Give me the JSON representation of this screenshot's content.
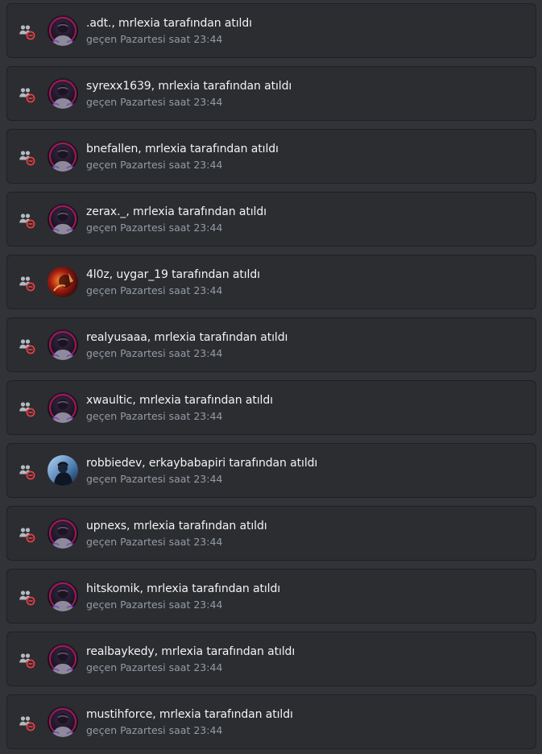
{
  "colors": {
    "background": "#313338",
    "card": "#2b2d31",
    "card_border": "#1f2023",
    "title_text": "#f2f3f5",
    "muted_text": "#949ba4",
    "icon_gray": "#b5bac1",
    "kick_red": "#f23f43"
  },
  "entry_icon": "member-kick-icon",
  "audit_log": {
    "entries": [
      {
        "text": ".adt., mrlexia tarafından atıldı",
        "time": "geçen Pazartesi saat 23:44",
        "avatar": "dark-masked-figure"
      },
      {
        "text": "syrexx1639, mrlexia tarafından atıldı",
        "time": "geçen Pazartesi saat 23:44",
        "avatar": "dark-masked-figure"
      },
      {
        "text": "bnefallen, mrlexia tarafından atıldı",
        "time": "geçen Pazartesi saat 23:44",
        "avatar": "dark-masked-figure"
      },
      {
        "text": "zerax._, mrlexia tarafından atıldı",
        "time": "geçen Pazartesi saat 23:44",
        "avatar": "dark-masked-figure"
      },
      {
        "text": "4l0z, uygar_19 tarafından atıldı",
        "time": "geçen Pazartesi saat 23:44",
        "avatar": "fiery-red-portrait"
      },
      {
        "text": "realyusaaa, mrlexia tarafından atıldı",
        "time": "geçen Pazartesi saat 23:44",
        "avatar": "dark-masked-figure"
      },
      {
        "text": "xwaultic, mrlexia tarafından atıldı",
        "time": "geçen Pazartesi saat 23:44",
        "avatar": "dark-masked-figure"
      },
      {
        "text": "robbiedev, erkaybabapiri tarafından atıldı",
        "time": "geçen Pazartesi saat 23:44",
        "avatar": "blue-hooded-figure"
      },
      {
        "text": "upnexs, mrlexia tarafından atıldı",
        "time": "geçen Pazartesi saat 23:44",
        "avatar": "dark-masked-figure"
      },
      {
        "text": "hitskomik, mrlexia tarafından atıldı",
        "time": "geçen Pazartesi saat 23:44",
        "avatar": "dark-masked-figure"
      },
      {
        "text": "realbaykedy, mrlexia tarafından atıldı",
        "time": "geçen Pazartesi saat 23:44",
        "avatar": "dark-masked-figure"
      },
      {
        "text": "mustihforce, mrlexia tarafından atıldı",
        "time": "geçen Pazartesi saat 23:44",
        "avatar": "dark-masked-figure"
      }
    ]
  }
}
